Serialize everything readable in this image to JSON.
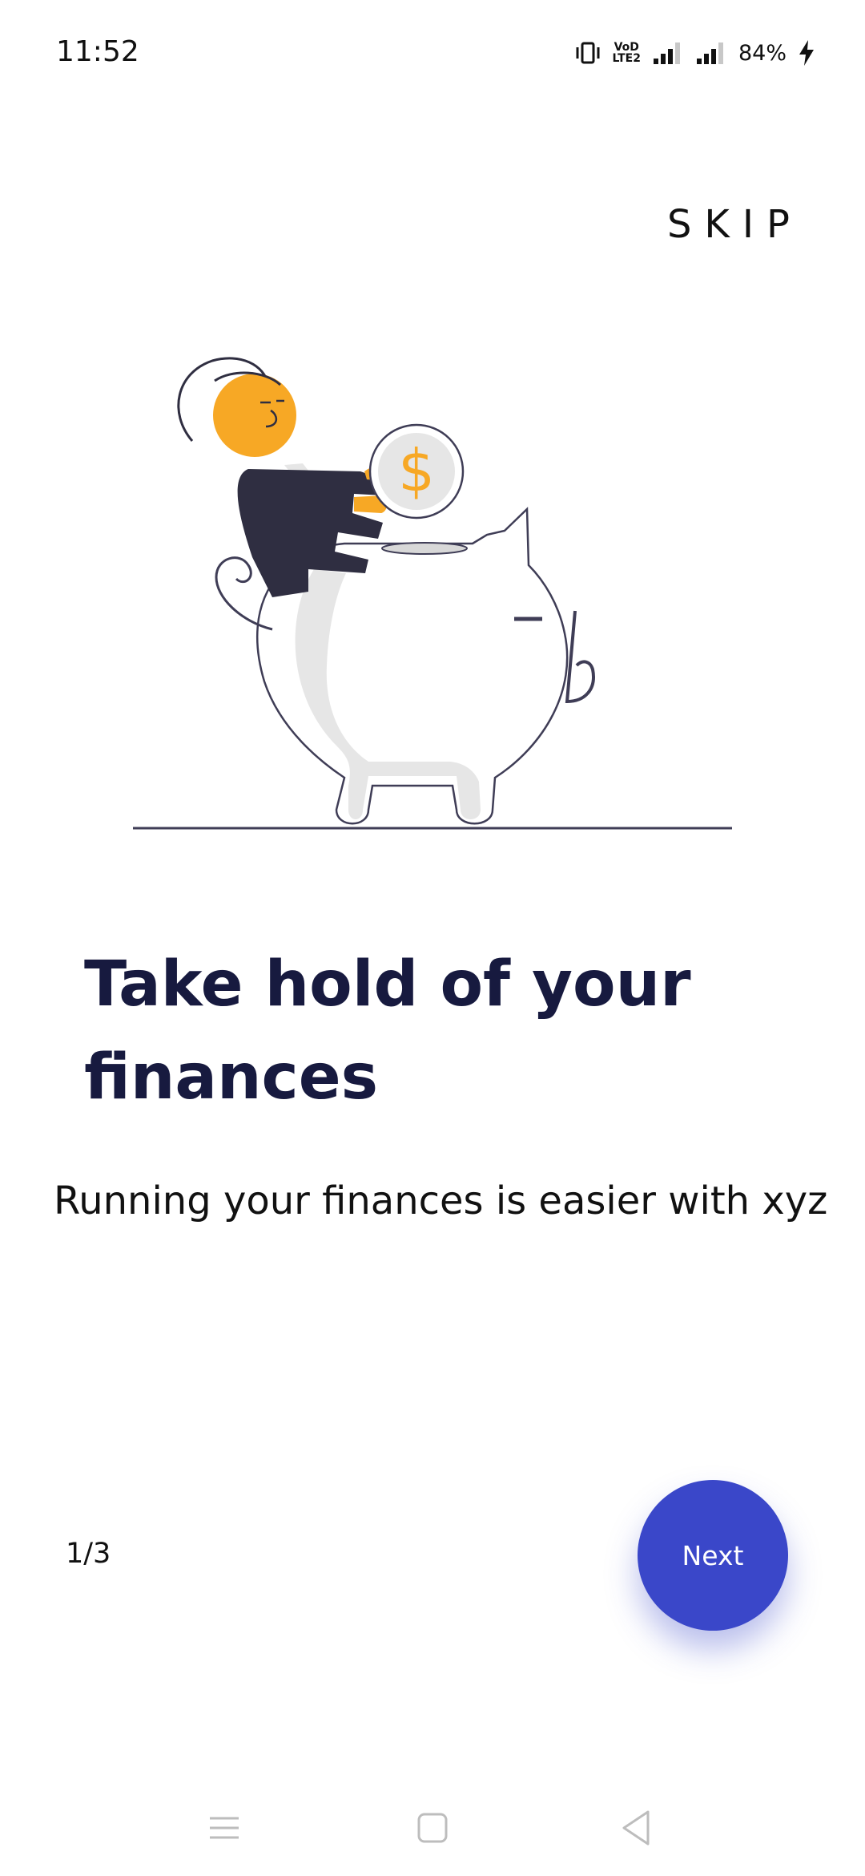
{
  "status_bar": {
    "time": "11:52",
    "battery_percent": "84%",
    "network_label_top": "VoD",
    "network_label_bottom": "LTE2",
    "icons": [
      "vibrate-icon",
      "volte-icon",
      "signal-icon",
      "signal-icon",
      "charging-icon"
    ]
  },
  "header": {
    "skip_label": "SKIP"
  },
  "illustration": {
    "coin_symbol": "$"
  },
  "content": {
    "title": "Take hold of your finances",
    "subtitle": "Running your finances is easier with xyz"
  },
  "footer": {
    "page_indicator": "1/3",
    "next_label": "Next"
  },
  "nav_bar": {
    "icons": [
      "menu-icon",
      "home-icon",
      "back-icon"
    ]
  },
  "colors": {
    "accent": "#3a47c9",
    "headline": "#171a3f",
    "character_orange": "#f7a825",
    "character_suit": "#2f2e41",
    "pig_shade": "#e6e6e6"
  }
}
